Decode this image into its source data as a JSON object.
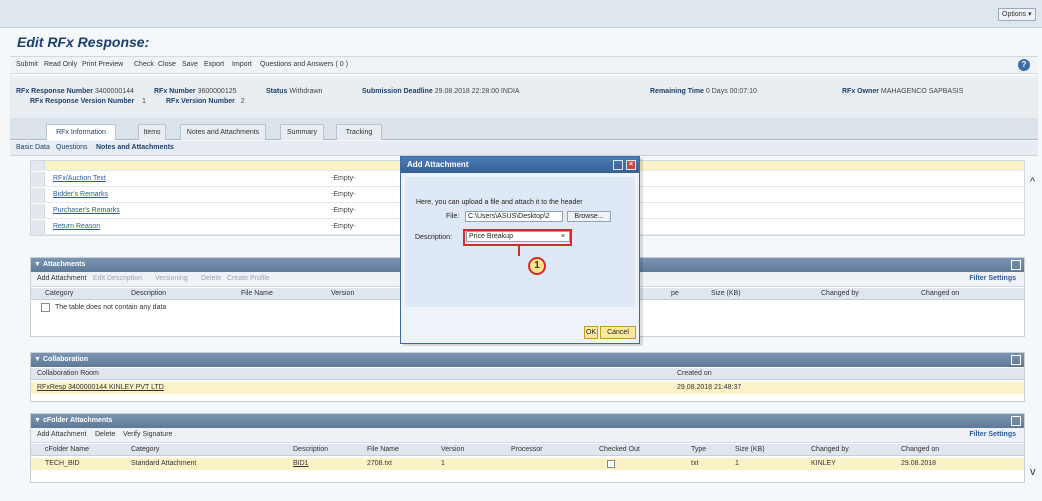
{
  "header": {
    "options_label": "Options ▾"
  },
  "page_title": "Edit RFx Response:",
  "toolbar": {
    "items": [
      "Submit",
      "Read Only",
      "Print Preview",
      "Check",
      "Close",
      "Save",
      "Export",
      "Import",
      "Questions and Answers ( 0 )"
    ],
    "help": "?"
  },
  "info": {
    "resp_num_label": "RFx Response Number",
    "resp_num_value": "3400000144",
    "rfx_num_label": "RFx Number",
    "rfx_num_value": "3600000125",
    "status_label": "Status",
    "status_value": "Withdrawn",
    "deadline_label": "Submission Deadline",
    "deadline_value": "29.08.2018 22:28:00 INDIA",
    "remaining_label": "Remaining Time",
    "remaining_value": "0 Days 00:07:10",
    "owner_label": "RFx Owner",
    "owner_value": "MAHAGENCO SAPBASIS",
    "resp_ver_label": "RFx Response Version Number",
    "resp_ver_value": "1",
    "rfx_ver_label": "RFx Version Number",
    "rfx_ver_value": "2"
  },
  "tabs": [
    "RFx Information",
    "Items",
    "Notes and Attachments",
    "Summary",
    "Tracking"
  ],
  "subtabs": [
    "Basic Data",
    "Questions",
    "Notes and Attachments"
  ],
  "remarks": [
    {
      "name": "RFx/Auction Text",
      "value": "-Empty-"
    },
    {
      "name": "Bidder's Remarks",
      "value": "-Empty-"
    },
    {
      "name": "Purchaser's Remarks",
      "value": "-Empty-"
    },
    {
      "name": "Return Reason",
      "value": "-Empty-"
    }
  ],
  "attachments": {
    "title": "Attachments",
    "tools": [
      "Add Attachment",
      "Edit Description",
      "Versioning",
      "Delete",
      "Create Profile"
    ],
    "filter": "Filter Settings",
    "columns": [
      "Category",
      "Description",
      "File Name",
      "Version",
      "pe",
      "Size (KB)",
      "Changed by",
      "Changed on"
    ],
    "empty_text": "The table does not contain any data"
  },
  "collaboration": {
    "title": "Collaboration",
    "col_room": "Collaboration Room",
    "col_created": "Created on",
    "room_value": "RFxResp 3400000144 KINLEY PVT LTD",
    "created_value": "29.08.2018 21:48:37"
  },
  "cfolder": {
    "title": "cFolder Attachments",
    "tools": [
      "Add Attachment",
      "Delete",
      "Verify Signature"
    ],
    "filter": "Filter Settings",
    "columns": [
      "cFolder Name",
      "Category",
      "Description",
      "File Name",
      "Version",
      "Processor",
      "Checked Out",
      "Type",
      "Size (KB)",
      "Changed by",
      "Changed on"
    ],
    "row": [
      "TECH_BID",
      "Standard Attachment",
      "BID1",
      "2708.txt",
      "1",
      "",
      "",
      "txt",
      "1",
      "KINLEY",
      "29.08.2018"
    ]
  },
  "dialog": {
    "title": "Add Attachment",
    "text": "Here, you can upload a file and attach it to the header",
    "file_label": "File:",
    "file_value": "C:\\Users\\ASUS\\Desktop\\2",
    "browse_label": "Browse...",
    "desc_label": "Description:",
    "desc_value": "Price Breakup",
    "clear_glyph": "×",
    "callout_number": "1",
    "ok_label": "OK",
    "cancel_label": "Cancel"
  }
}
